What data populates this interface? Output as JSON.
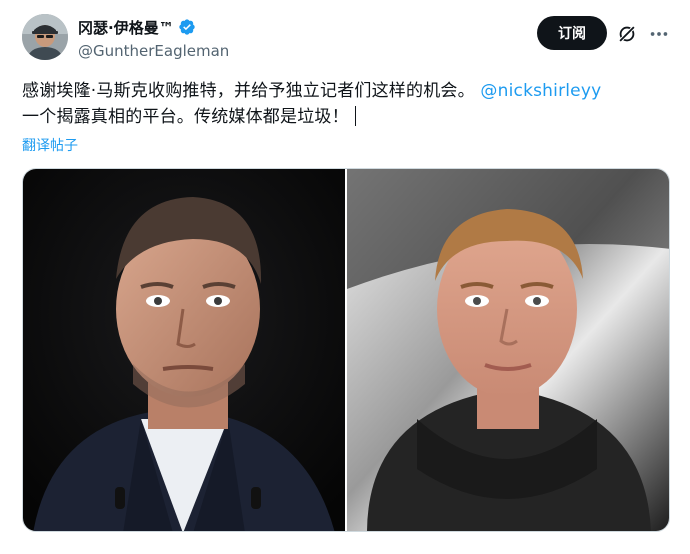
{
  "author": {
    "display_name": "冈瑟·伊格曼™",
    "handle": "@GuntherEagleman",
    "verified": true
  },
  "actions": {
    "subscribe_label": "订阅",
    "grok_icon": "grok-slash-icon",
    "more_icon": "more-dots-icon"
  },
  "tweet": {
    "text_part1": "感谢埃隆·马斯克收购推特，并给予独立记者们这样的机会。",
    "mention": "@nickshirleyy",
    "text_part2": "一个揭露真相的平台。传统媒体都是垃圾！"
  },
  "translate": {
    "label": "翻译帖子"
  },
  "media": {
    "left_photo": "portrait-man-suit",
    "right_photo": "portrait-young-man-hoodie"
  },
  "colors": {
    "accent": "#1d9bf0",
    "text": "#0f1419",
    "secondary": "#536471",
    "button_bg": "#0f1419"
  }
}
